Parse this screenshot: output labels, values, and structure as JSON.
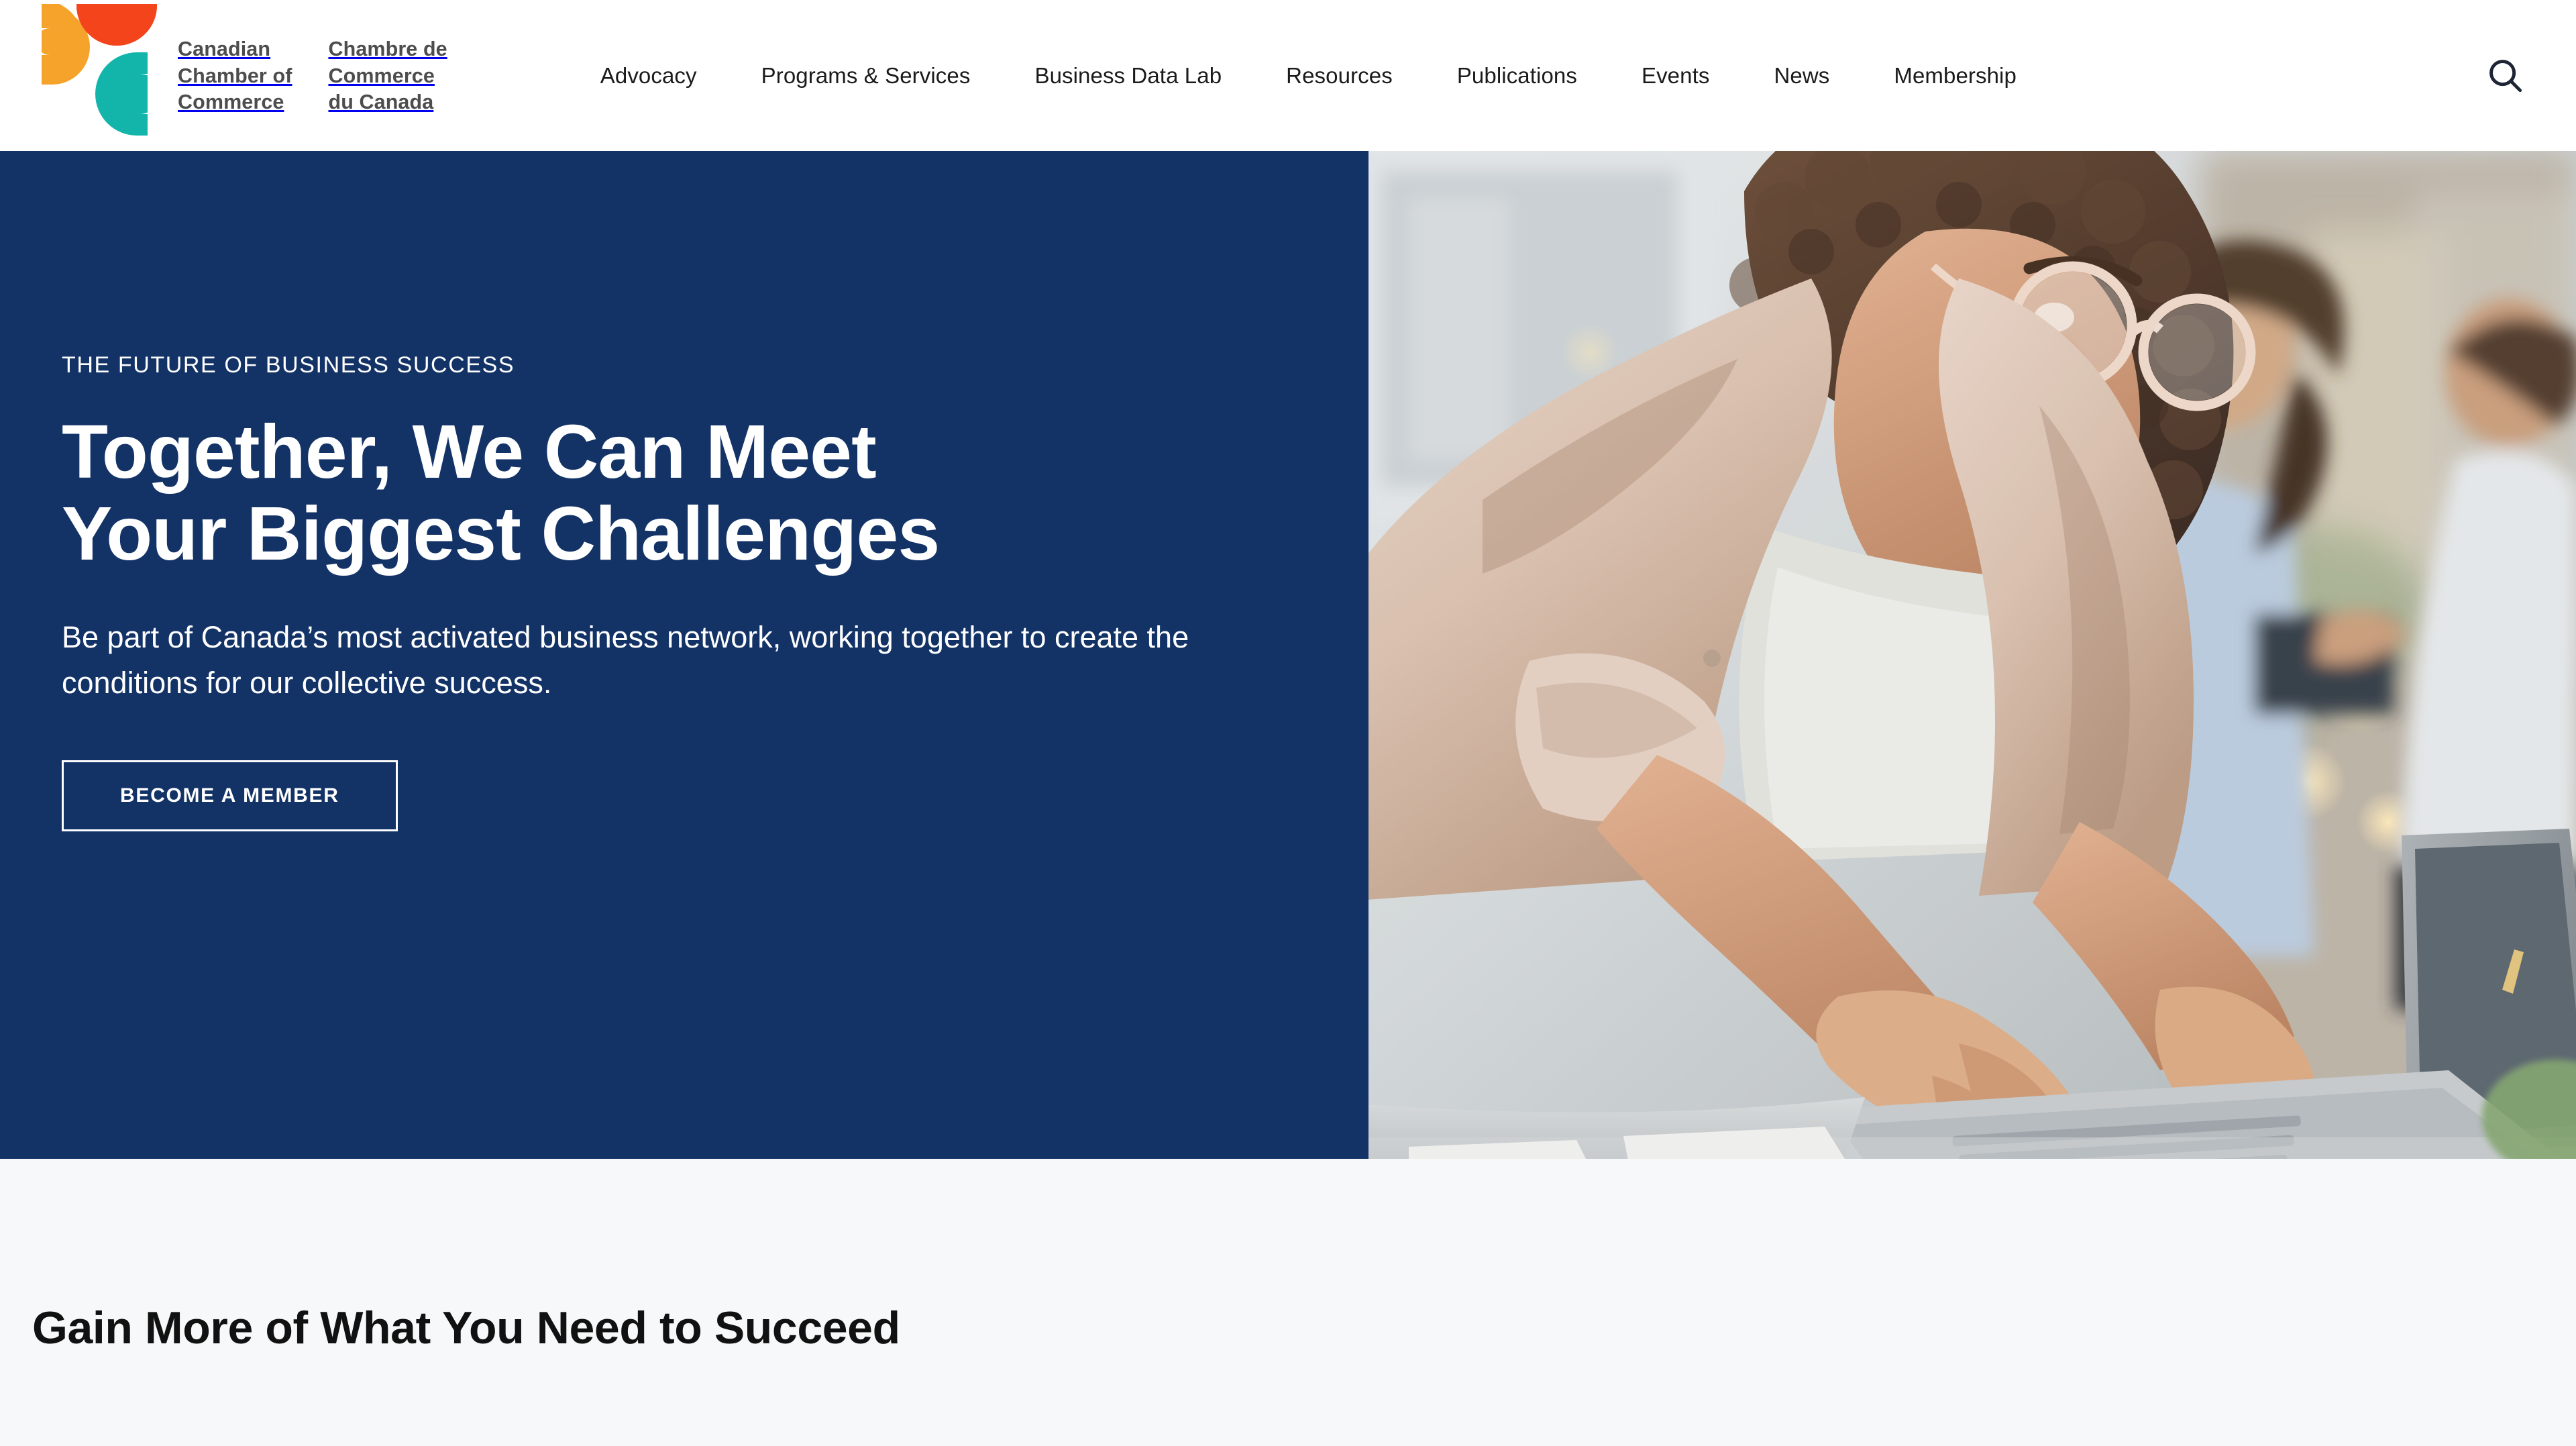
{
  "header": {
    "logo": {
      "mark_name": "canadian-chamber-logo-mark",
      "colors": {
        "orange": "#F5A32A",
        "red": "#F4441B",
        "teal": "#13B5AB"
      },
      "wordmark_en": [
        "Canadian",
        "Chamber of",
        "Commerce"
      ],
      "wordmark_fr": [
        "Chambre de",
        "Commerce",
        "du Canada"
      ]
    },
    "nav": [
      {
        "label": "Advocacy",
        "name": "nav-advocacy"
      },
      {
        "label": "Programs & Services",
        "name": "nav-programs-services"
      },
      {
        "label": "Business Data Lab",
        "name": "nav-business-data-lab"
      },
      {
        "label": "Resources",
        "name": "nav-resources"
      },
      {
        "label": "Publications",
        "name": "nav-publications"
      },
      {
        "label": "Events",
        "name": "nav-events"
      },
      {
        "label": "News",
        "name": "nav-news"
      },
      {
        "label": "Membership",
        "name": "nav-membership"
      }
    ],
    "search_icon": "search-icon"
  },
  "hero": {
    "eyebrow": "THE FUTURE OF BUSINESS SUCCESS",
    "title_line1": "Together, We Can Meet",
    "title_line2": "Your Biggest Challenges",
    "body": "Be part of Canada’s most activated business network, working together to create the conditions for our collective success.",
    "cta_label": "BECOME A MEMBER",
    "background_color": "#133367",
    "photo_alt": "Smiling woman with curly hair and glasses in a blazer leaning over a laptop in an office, colleagues blurred behind"
  },
  "lower": {
    "section_title": "Gain More of What You Need to Succeed",
    "background_color": "#F7F8F9"
  }
}
